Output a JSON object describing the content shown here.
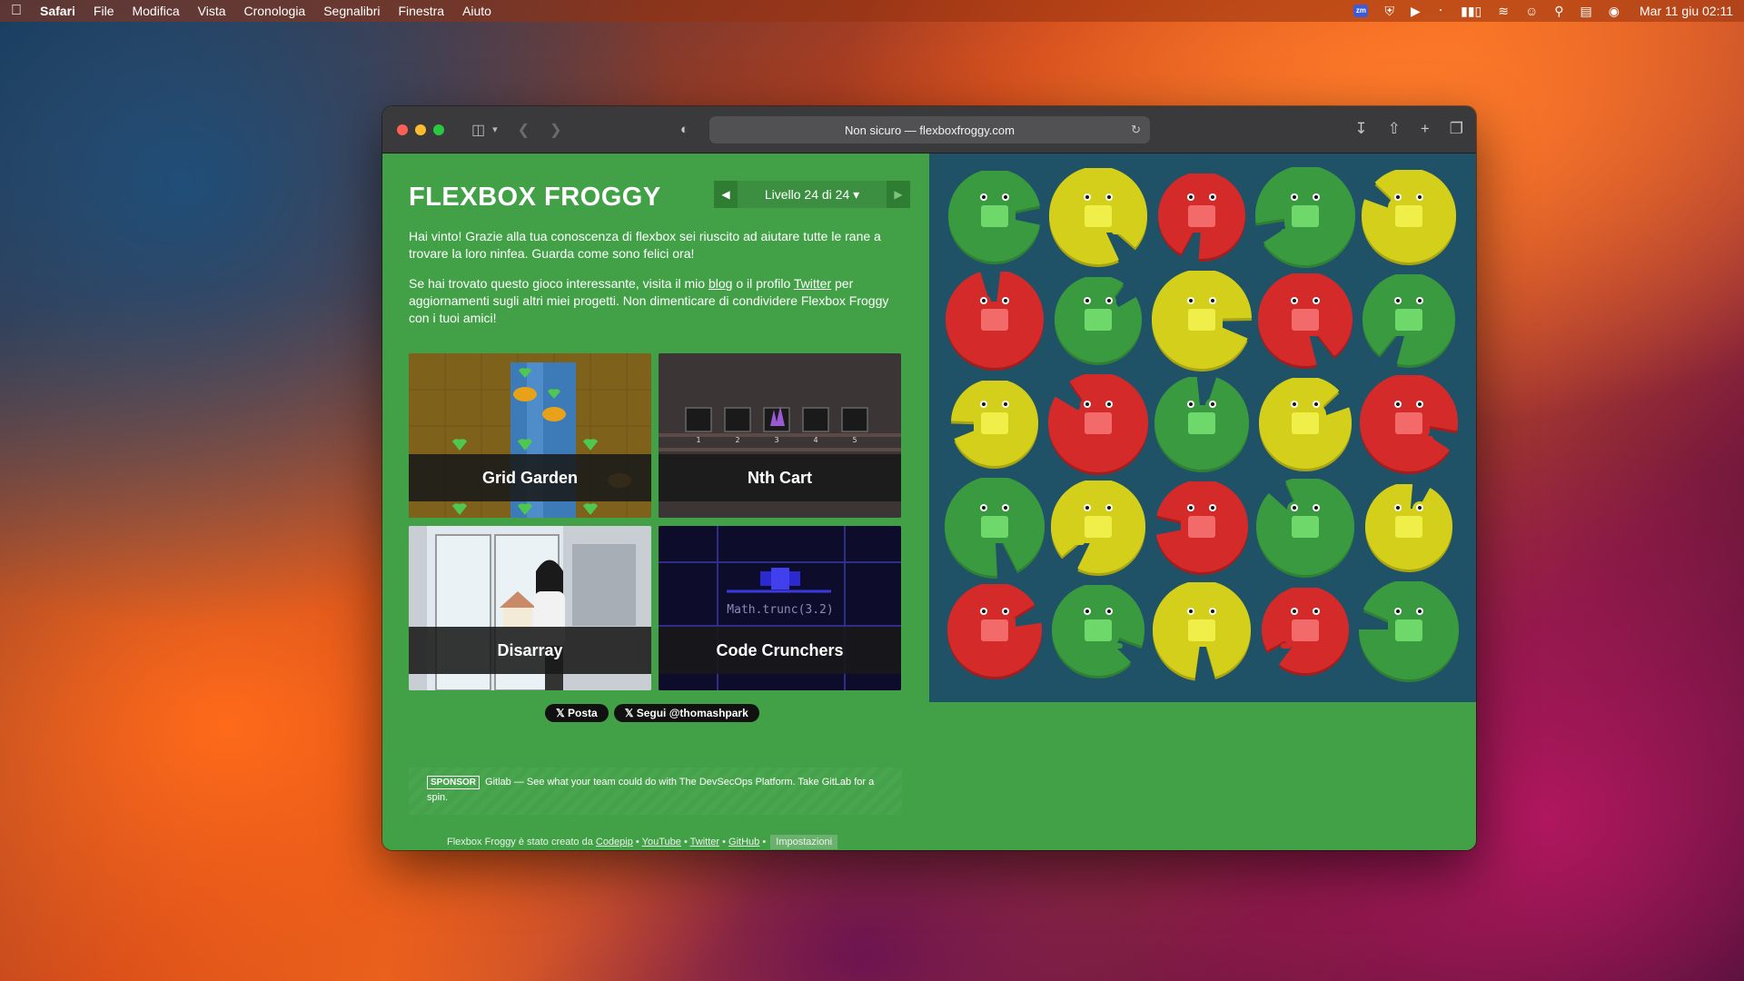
{
  "menubar": {
    "app": "Safari",
    "items": [
      "File",
      "Modifica",
      "Vista",
      "Cronologia",
      "Segnalibri",
      "Finestra",
      "Aiuto"
    ],
    "zm_label": "zm",
    "clock": "Mar 11 giu 02:11"
  },
  "browser": {
    "address": "Non sicuro — flexboxfroggy.com"
  },
  "game": {
    "title": "FLEXBOX FROGGY",
    "level_label": "Livello 24 di 24",
    "win_text": "Hai vinto! Grazie alla tua conoscenza di flexbox sei riuscito ad aiutare tutte le rane a trovare la loro ninfea. Guarda come sono felici ora!",
    "promo_1": "Se hai trovato questo gioco interessante, visita il mio",
    "promo_blog": "blog",
    "promo_2": "o il profilo",
    "promo_twitter": "Twitter",
    "promo_3": "per aggiornamenti sugli altri miei progetti. Non dimenticare di condividere Flexbox Froggy con i tuoi amici!",
    "tiles": [
      "Grid Garden",
      "Nth Cart",
      "Disarray",
      "Code Crunchers"
    ],
    "code_crunchers_code": "Math.trunc(3.2)",
    "nth_cart_numbers": [
      "1",
      "2",
      "3",
      "4",
      "5"
    ],
    "share_post": "Posta",
    "share_follow": "Segui @thomashpark",
    "sponsor_badge": "SPONSOR",
    "sponsor_text": "Gitlab — See what your team could do with The DevSecOps Platform. Take GitLab for a spin.",
    "footer_prefix": "Flexbox Froggy è stato creato da",
    "footer_links": [
      "Codepip",
      "YouTube",
      "Twitter",
      "GitHub"
    ],
    "footer_sep": "•",
    "footer_settings": "Impostazioni"
  },
  "colors": {
    "green_pad": "#3a9a3f",
    "yellow_pad": "#d4cf1a",
    "red_pad": "#d52a2a",
    "green_frog": "#6fd86a",
    "yellow_frog": "#f0ef4a",
    "red_frog": "#f26a6a"
  },
  "pond": {
    "rows": [
      [
        "green",
        "yellow",
        "red",
        "green",
        "yellow"
      ],
      [
        "red",
        "green",
        "yellow",
        "red",
        "green"
      ],
      [
        "yellow",
        "red",
        "green",
        "yellow",
        "red"
      ],
      [
        "green",
        "yellow",
        "red",
        "green",
        "yellow"
      ],
      [
        "red",
        "green",
        "yellow",
        "red",
        "green"
      ]
    ]
  }
}
